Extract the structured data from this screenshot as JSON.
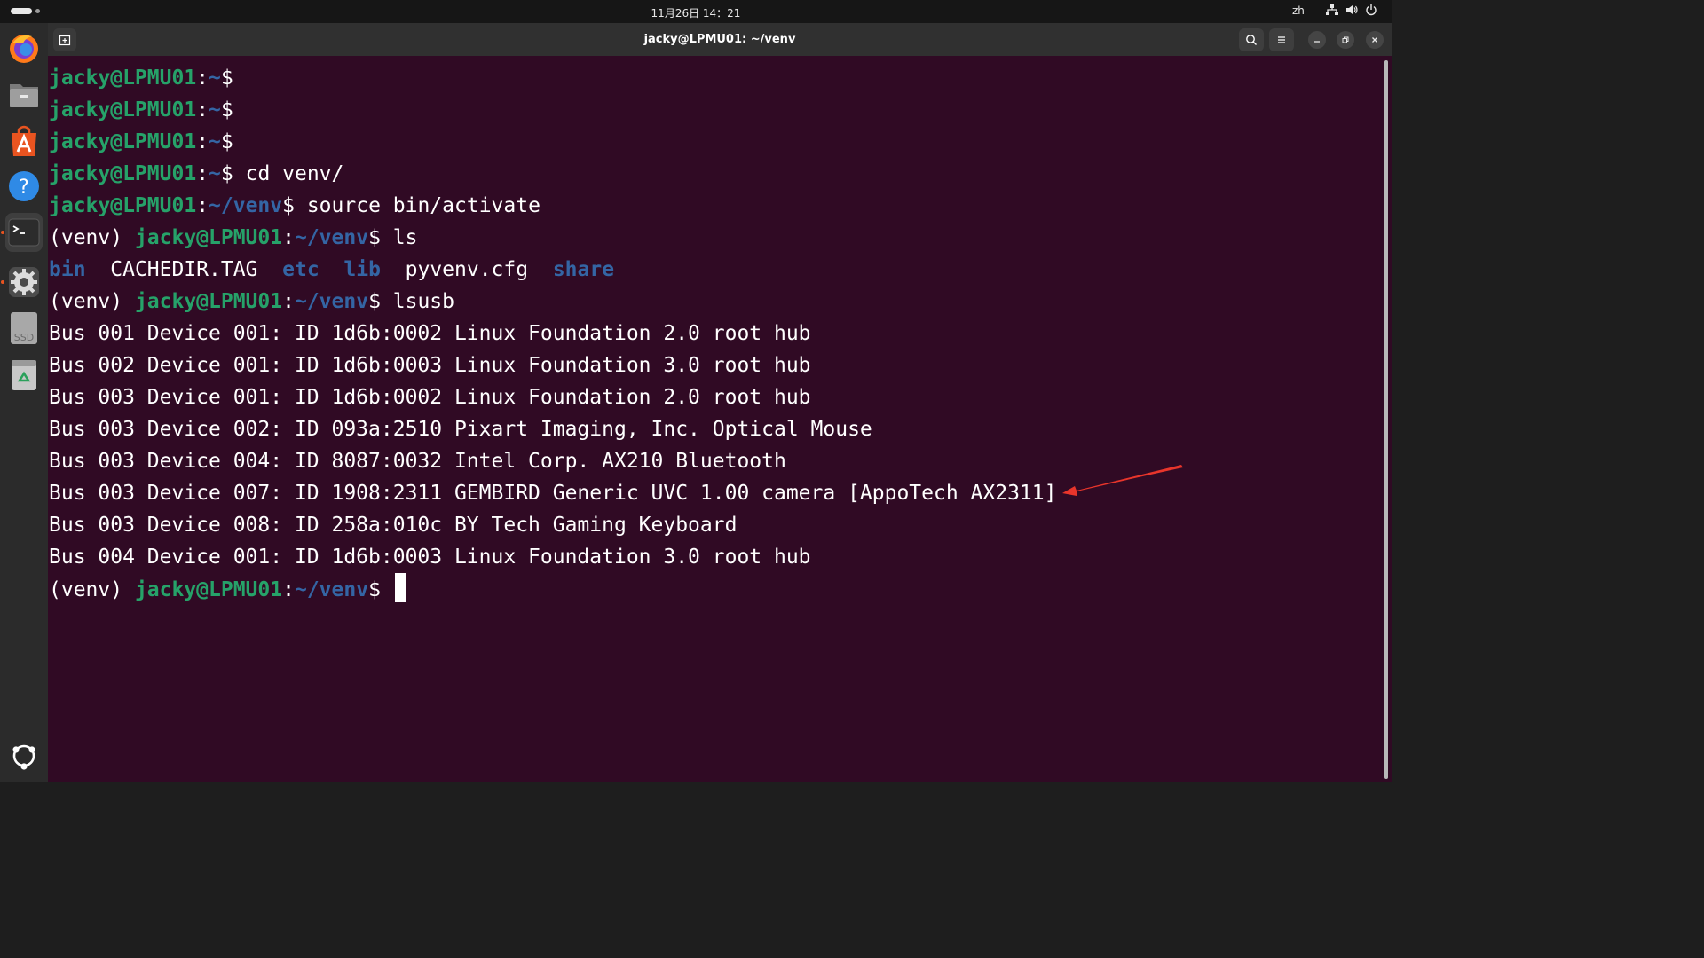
{
  "topbar": {
    "clock": "11月26日 14：21",
    "language": "zh"
  },
  "dock": {
    "apps": [
      {
        "name": "Firefox",
        "icon": "firefox-icon"
      },
      {
        "name": "Files",
        "icon": "files-icon"
      },
      {
        "name": "App Center",
        "icon": "app-center-icon"
      },
      {
        "name": "Help",
        "icon": "help-icon"
      },
      {
        "name": "Terminal",
        "icon": "terminal-icon",
        "active": true
      },
      {
        "name": "Settings",
        "icon": "settings-icon"
      },
      {
        "name": "SSD",
        "icon": "ssd-drive-icon",
        "label": "SSD"
      },
      {
        "name": "Trash",
        "icon": "trash-icon"
      },
      {
        "name": "Show Apps",
        "icon": "show-apps-icon"
      }
    ]
  },
  "window": {
    "title": "jacky@LPMU01: ~/venv"
  },
  "terminal": {
    "user_host": "jacky@LPMU01",
    "venv": "(venv) ",
    "lines": [
      {
        "prefix": "",
        "path": "~",
        "cmd": ""
      },
      {
        "prefix": "",
        "path": "~",
        "cmd": ""
      },
      {
        "prefix": "",
        "path": "~",
        "cmd": ""
      },
      {
        "prefix": "",
        "path": "~",
        "cmd": " cd venv/"
      },
      {
        "prefix": "",
        "path": "~/venv",
        "cmd": " source bin/activate"
      },
      {
        "prefix": "(venv) ",
        "path": "~/venv",
        "cmd": " ls"
      }
    ],
    "ls_output": [
      {
        "name": "bin",
        "dir": true
      },
      {
        "name": "CACHEDIR.TAG",
        "dir": false
      },
      {
        "name": "etc",
        "dir": true
      },
      {
        "name": "lib",
        "dir": true
      },
      {
        "name": "pyvenv.cfg",
        "dir": false
      },
      {
        "name": "share",
        "dir": true
      }
    ],
    "lsusb_prompt": {
      "prefix": "(venv) ",
      "path": "~/venv",
      "cmd": " lsusb"
    },
    "lsusb_output": [
      "Bus 001 Device 001: ID 1d6b:0002 Linux Foundation 2.0 root hub",
      "Bus 002 Device 001: ID 1d6b:0003 Linux Foundation 3.0 root hub",
      "Bus 003 Device 001: ID 1d6b:0002 Linux Foundation 2.0 root hub",
      "Bus 003 Device 002: ID 093a:2510 Pixart Imaging, Inc. Optical Mouse",
      "Bus 003 Device 004: ID 8087:0032 Intel Corp. AX210 Bluetooth",
      "Bus 003 Device 007: ID 1908:2311 GEMBIRD Generic UVC 1.00 camera [AppoTech AX2311]",
      "Bus 003 Device 008: ID 258a:010c BY Tech Gaming Keyboard",
      "Bus 004 Device 001: ID 1d6b:0003 Linux Foundation 3.0 root hub"
    ],
    "final_prompt": {
      "prefix": "(venv) ",
      "path": "~/venv",
      "cmd": " "
    }
  },
  "colors": {
    "terminal_bg": "#300a24",
    "user_green": "#26a269",
    "path_blue": "#3465a4",
    "annotation_red": "#e8352b"
  }
}
